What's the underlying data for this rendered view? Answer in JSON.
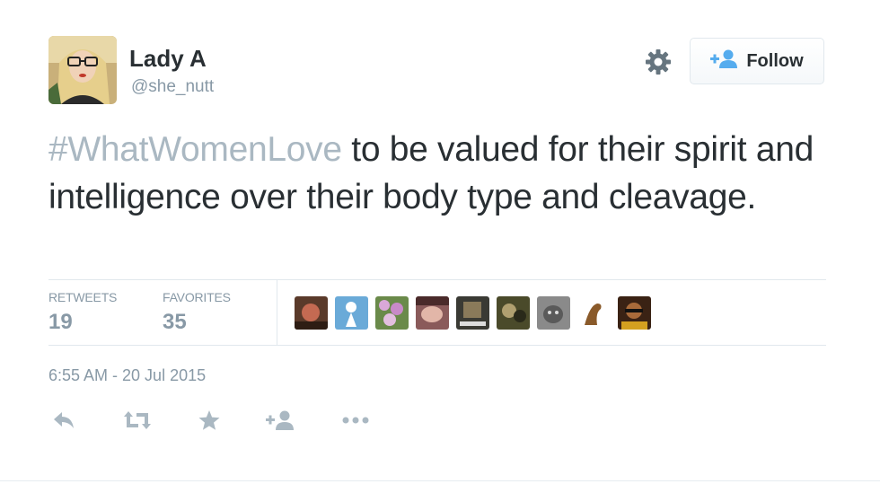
{
  "user": {
    "display_name": "Lady A",
    "handle": "@she_nutt"
  },
  "header": {
    "follow_label": "Follow"
  },
  "tweet": {
    "hashtag": "#WhatWomenLove",
    "body": " to be valued for their spirit and intelligence over their body type and cleavage."
  },
  "stats": {
    "retweets_label": "RETWEETS",
    "retweets_count": "19",
    "favorites_label": "FAVORITES",
    "favorites_count": "35"
  },
  "timestamp": "6:55 AM - 20 Jul 2015",
  "actions": [
    "reply-icon",
    "retweet-icon",
    "favorite-icon",
    "follow-icon",
    "more-icon"
  ],
  "colors": {
    "text": "#292f33",
    "muted": "#8899a6",
    "hashtag": "#aab8c2",
    "action_icon": "#aab8c2",
    "follow_icon": "#55acee",
    "divider": "#e1e8ed"
  }
}
